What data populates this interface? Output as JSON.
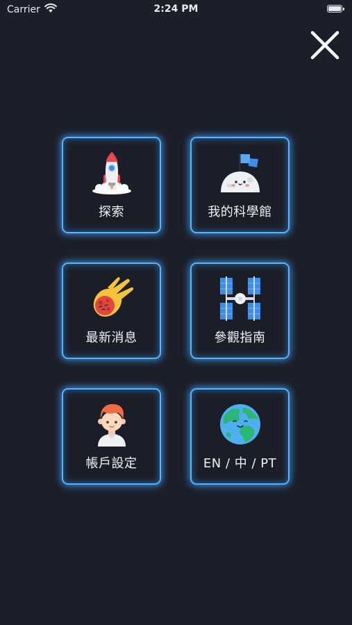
{
  "status_bar": {
    "carrier": "Carrier",
    "time": "2:24 PM",
    "wifi_icon": "wifi-icon",
    "battery_icon": "battery-icon"
  },
  "close_icon": "close-icon",
  "accent_color": "#4fb6ff",
  "background_color": "#1c1f29",
  "menu": {
    "items": [
      {
        "label": "探索",
        "icon": "rocket-icon"
      },
      {
        "label": "我的科學館",
        "icon": "moon-flag-icon"
      },
      {
        "label": "最新消息",
        "icon": "meteor-icon"
      },
      {
        "label": "參觀指南",
        "icon": "space-station-icon"
      },
      {
        "label": "帳戶設定",
        "icon": "person-avatar-icon"
      },
      {
        "label": "EN / 中 / PT",
        "icon": "earth-globe-icon"
      }
    ]
  }
}
